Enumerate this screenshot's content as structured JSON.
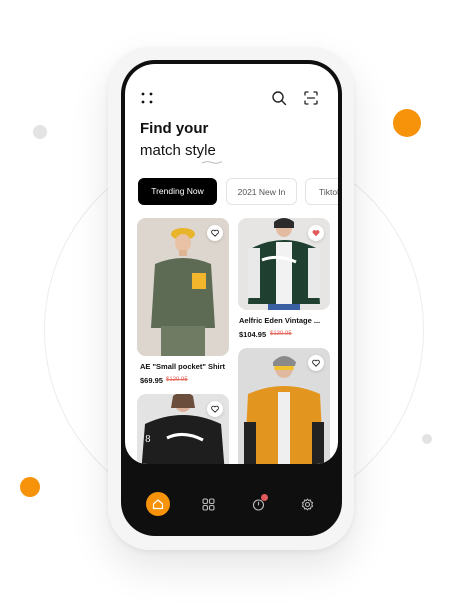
{
  "colors": {
    "accent": "#f7930a",
    "dark": "#0f0f0f",
    "sale": "#e2675a",
    "liked": "#e35a5a"
  },
  "header": {
    "title_line1": "Find your",
    "title_line2": "match style"
  },
  "icons": [
    "grid-dots-icon",
    "search-icon",
    "scan-icon",
    "heart-icon",
    "home-icon",
    "apps-icon",
    "timer-icon",
    "settings-icon"
  ],
  "tabs": [
    {
      "label": "Trending Now",
      "active": true
    },
    {
      "label": "2021 New In",
      "active": false
    },
    {
      "label": "Tiktok",
      "active": false
    }
  ],
  "products": [
    {
      "name": "AE \"Small pocket\" Shirt",
      "price": "$69.95",
      "old_price": "$129.95",
      "liked": false
    },
    {
      "name": "Aelfric Eden Vintage ...",
      "price": "$104.95",
      "old_price": "$139.95",
      "liked": true
    },
    {
      "name": "",
      "price": "",
      "old_price": "",
      "liked": false
    },
    {
      "name": "",
      "price": "",
      "old_price": "",
      "liked": false
    }
  ],
  "nav": {
    "items": [
      "home",
      "apps",
      "timer",
      "settings"
    ],
    "active": "home",
    "badge_on": "timer"
  }
}
